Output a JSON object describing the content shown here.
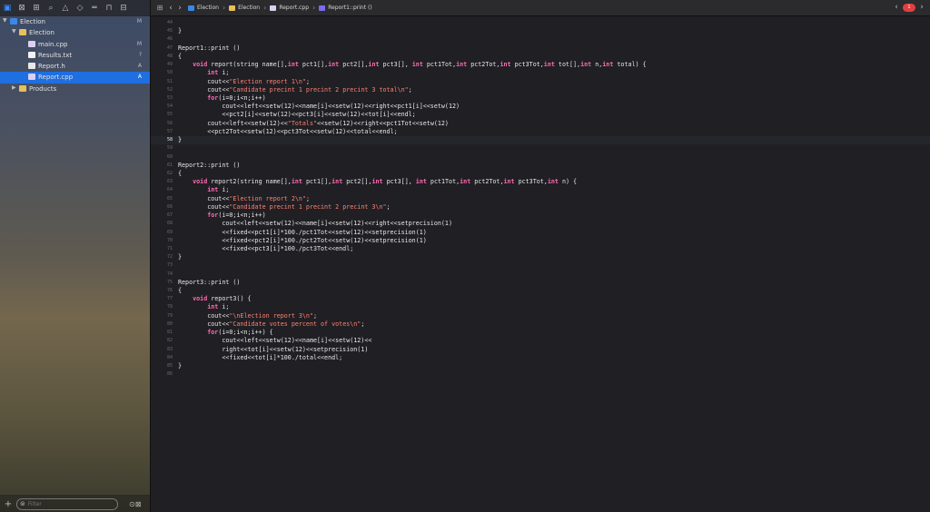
{
  "toolbar": {
    "icons": [
      "folder-icon",
      "source-control-icon",
      "symbol-icon",
      "find-icon",
      "warning-icon",
      "test-icon",
      "debug-icon",
      "breakpoint-icon",
      "report-icon"
    ]
  },
  "tree": [
    {
      "label": "Election",
      "status": "M",
      "kind": "project",
      "level": 0,
      "disclosure": "▼",
      "selected": false
    },
    {
      "label": "Election",
      "status": "",
      "kind": "folder",
      "level": 1,
      "disclosure": "▼",
      "selected": false
    },
    {
      "label": "main.cpp",
      "status": "M",
      "kind": "cpp",
      "level": 2,
      "disclosure": "",
      "selected": false
    },
    {
      "label": "Results.txt",
      "status": "?",
      "kind": "txt",
      "level": 2,
      "disclosure": "",
      "selected": false
    },
    {
      "label": "Report.h",
      "status": "A",
      "kind": "file",
      "level": 2,
      "disclosure": "",
      "selected": false
    },
    {
      "label": "Report.cpp",
      "status": "A",
      "kind": "cpp",
      "level": 2,
      "disclosure": "",
      "selected": true
    },
    {
      "label": "Products",
      "status": "",
      "kind": "folder",
      "level": 1,
      "disclosure": "▶",
      "selected": false
    }
  ],
  "filter": {
    "placeholder": "Filter"
  },
  "breadcrumb": [
    {
      "label": "Election",
      "kind": "project"
    },
    {
      "label": "Election",
      "kind": "folder"
    },
    {
      "label": "Report.cpp",
      "kind": "cpp"
    },
    {
      "label": "Report1::print ()",
      "kind": "method"
    }
  ],
  "error_badge": "1",
  "colors": {
    "accent": "#1f6fe0",
    "keyword": "#ff6ab3",
    "string": "#ff8170",
    "background": "#1f1f24"
  },
  "current_line": 58,
  "code": [
    {
      "n": 44,
      "t": ""
    },
    {
      "n": 45,
      "t": "}"
    },
    {
      "n": 46,
      "t": ""
    },
    {
      "n": 47,
      "t": "Report1::print ()"
    },
    {
      "n": 48,
      "t": "{"
    },
    {
      "n": 49,
      "t": "    void report(string name[],int pct1[],int pct2[],int pct3[], int pct1Tot,int pct2Tot,int pct3Tot,int tot[],int n,int total) {"
    },
    {
      "n": 50,
      "t": "        int i;"
    },
    {
      "n": 51,
      "t": "        cout<<\"Election report 1\\n\";"
    },
    {
      "n": 52,
      "t": "        cout<<\"Candidate precint 1 precint 2 precint 3 total\\n\";"
    },
    {
      "n": 53,
      "t": "        for(i=0;i<n;i++)"
    },
    {
      "n": 54,
      "t": "            cout<<left<<setw(12)<<name[i]<<setw(12)<<right<<pct1[i]<<setw(12)"
    },
    {
      "n": 55,
      "t": "            <<pct2[i]<<setw(12)<<pct3[i]<<setw(12)<<tot[i]<<endl;"
    },
    {
      "n": 56,
      "t": "        cout<<left<<setw(12)<<\"Totals\"<<setw(12)<<right<<pct1Tot<<setw(12)"
    },
    {
      "n": 57,
      "t": "        <<pct2Tot<<setw(12)<<pct3Tot<<setw(12)<<total<<endl;"
    },
    {
      "n": 58,
      "t": "}"
    },
    {
      "n": 59,
      "t": ""
    },
    {
      "n": 60,
      "t": ""
    },
    {
      "n": 61,
      "t": "Report2::print ()"
    },
    {
      "n": 62,
      "t": "{"
    },
    {
      "n": 63,
      "t": "    void report2(string name[],int pct1[],int pct2[],int pct3[], int pct1Tot,int pct2Tot,int pct3Tot,int n) {"
    },
    {
      "n": 64,
      "t": "        int i;"
    },
    {
      "n": 65,
      "t": "        cout<<\"Election report 2\\n\";"
    },
    {
      "n": 66,
      "t": "        cout<<\"Candidate precint 1 precint 2 precint 3\\n\";"
    },
    {
      "n": 67,
      "t": "        for(i=0;i<n;i++)"
    },
    {
      "n": 68,
      "t": "            cout<<left<<setw(12)<<name[i]<<setw(12)<<right<<setprecision(1)"
    },
    {
      "n": 69,
      "t": "            <<fixed<<pct1[i]*100./pct1Tot<<setw(12)<<setprecision(1)"
    },
    {
      "n": 70,
      "t": "            <<fixed<<pct2[i]*100./pct2Tot<<setw(12)<<setprecision(1)"
    },
    {
      "n": 71,
      "t": "            <<fixed<<pct3[i]*100./pct3Tot<<endl;"
    },
    {
      "n": 72,
      "t": "}"
    },
    {
      "n": 73,
      "t": ""
    },
    {
      "n": 74,
      "t": ""
    },
    {
      "n": 75,
      "t": "Report3::print ()"
    },
    {
      "n": 76,
      "t": "{"
    },
    {
      "n": 77,
      "t": "    void report3() {"
    },
    {
      "n": 78,
      "t": "        int i;"
    },
    {
      "n": 79,
      "t": "        cout<<\"\\nElection report 3\\n\";"
    },
    {
      "n": 80,
      "t": "        cout<<\"Candidate votes percent of votes\\n\";"
    },
    {
      "n": 81,
      "t": "        for(i=0;i<n;i++) {"
    },
    {
      "n": 82,
      "t": "            cout<<left<<setw(12)<<name[i]<<setw(12)<<"
    },
    {
      "n": 83,
      "t": "            right<<tot[i]<<setw(12)<<setprecision(1)"
    },
    {
      "n": 84,
      "t": "            <<fixed<<tot[i]*100./total<<endl;"
    },
    {
      "n": 85,
      "t": "}"
    },
    {
      "n": 86,
      "t": ""
    }
  ]
}
